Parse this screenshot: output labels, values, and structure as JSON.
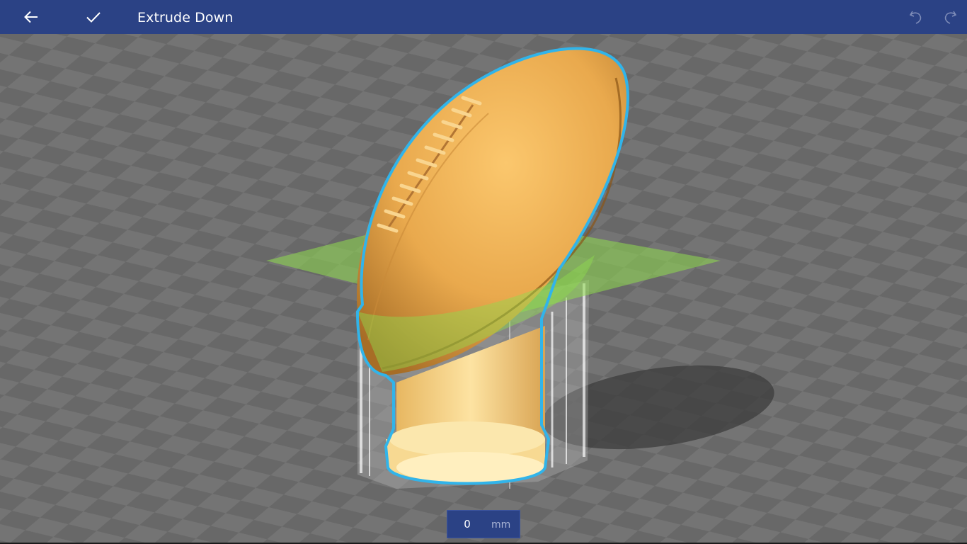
{
  "toolbar": {
    "title": "Extrude Down",
    "back_icon": "arrow-left-icon",
    "confirm_icon": "checkmark-icon",
    "undo_icon": "undo-icon",
    "redo_icon": "redo-icon"
  },
  "extrude": {
    "value": "0",
    "unit": "mm"
  },
  "colors": {
    "toolbar_bg": "#2b4285",
    "selection_outline": "#31b4ea",
    "cut_plane": "#8fdc4e",
    "model": "#f0b556"
  }
}
